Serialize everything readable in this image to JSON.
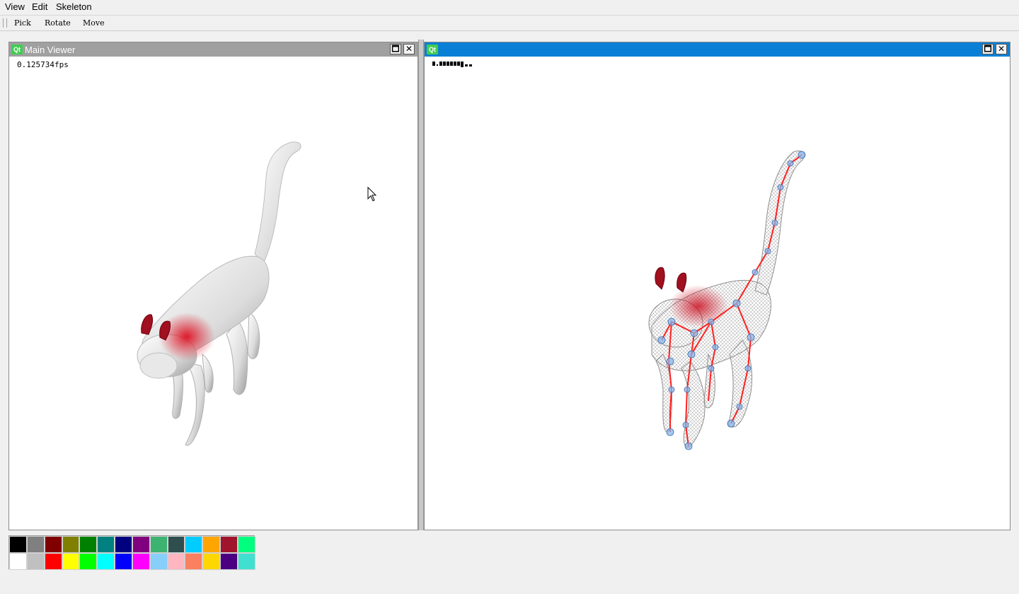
{
  "menubar": {
    "items": [
      "View",
      "Edit",
      "Skeleton"
    ]
  },
  "toolbar": {
    "pick_label": "Pick",
    "rotate_label": "Rotate",
    "move_label": "Move"
  },
  "main_viewer": {
    "title": "Main Viewer",
    "fps_text": "0.125734fps",
    "maximize_glyph": "🗖",
    "close_glyph": "✕",
    "titlebar_color": "#a0a0a0"
  },
  "skeleton_viewer": {
    "title": "",
    "fps_text": "",
    "maximize_glyph": "🗖",
    "close_glyph": "✕",
    "titlebar_color": "#0a7fd6"
  },
  "icons": {
    "app_icon_text": "Qt"
  },
  "palette": {
    "row1": [
      "#000000",
      "#808080",
      "#800000",
      "#808000",
      "#008000",
      "#008080",
      "#000080",
      "#800080",
      "#3cb371",
      "#2f4f4f",
      "#00ccff",
      "#ffa500",
      "#a0142c",
      "#00ff7f"
    ],
    "row2": [
      "#ffffff",
      "#c0c0c0",
      "#ff0000",
      "#ffff00",
      "#00ff00",
      "#00ffff",
      "#0000ff",
      "#ff00ff",
      "#87cefa",
      "#ffb6c1",
      "#fa8060",
      "#ffd700",
      "#4b0082",
      "#40e0d0"
    ]
  },
  "colors": {
    "heat": "#cc1122",
    "bone": "#ff2222",
    "joint": "#8ab4e8"
  }
}
